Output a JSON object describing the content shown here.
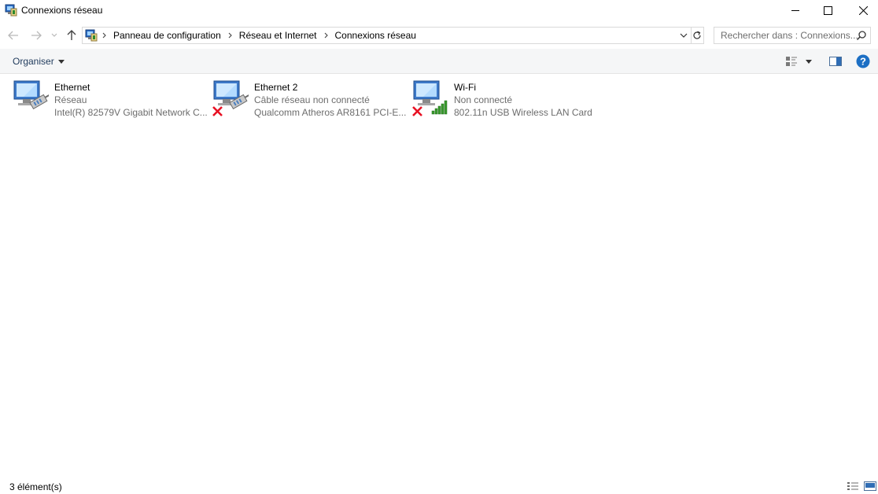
{
  "window": {
    "title": "Connexions réseau"
  },
  "address": {
    "crumbs": [
      "Panneau de configuration",
      "Réseau et Internet",
      "Connexions réseau"
    ]
  },
  "search": {
    "placeholder": "Rechercher dans : Connexions..."
  },
  "command_bar": {
    "organise_label": "Organiser"
  },
  "connections": [
    {
      "name": "Ethernet",
      "status": "Réseau",
      "device": "Intel(R) 82579V Gigabit Network C...",
      "type": "ethernet",
      "disconnected": false
    },
    {
      "name": "Ethernet 2",
      "status": "Câble réseau non connecté",
      "device": "Qualcomm Atheros AR8161 PCI-E...",
      "type": "ethernet",
      "disconnected": true
    },
    {
      "name": "Wi-Fi",
      "status": "Non connecté",
      "device": "802.11n USB Wireless LAN Card",
      "type": "wifi",
      "disconnected": true
    }
  ],
  "status_bar": {
    "count": "3 élément(s)"
  },
  "colors": {
    "help_blue": "#1c6fc4",
    "link_text": "#1e395b",
    "disconnect_red": "#e81123",
    "signal_green": "#3a9b2e"
  }
}
